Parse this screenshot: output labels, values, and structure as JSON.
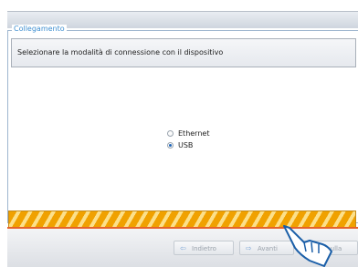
{
  "group": {
    "title": "Collegamento"
  },
  "instruction": "Selezionare la modalità di connessione con il dispositivo",
  "options": [
    {
      "label": "Ethernet",
      "selected": false
    },
    {
      "label": "USB",
      "selected": true
    }
  ],
  "progress": {
    "fraction": 1.0
  },
  "buttons": {
    "back": "Indietro",
    "next": "Avanti",
    "cancel": "Annulla"
  },
  "icons": {
    "back": "arrow-left-icon",
    "next": "arrow-right-icon",
    "cancel": "cancel-icon"
  },
  "colors": {
    "accent": "#3f8fd0",
    "progress": "#f0a100",
    "divider": "#e6632a"
  }
}
